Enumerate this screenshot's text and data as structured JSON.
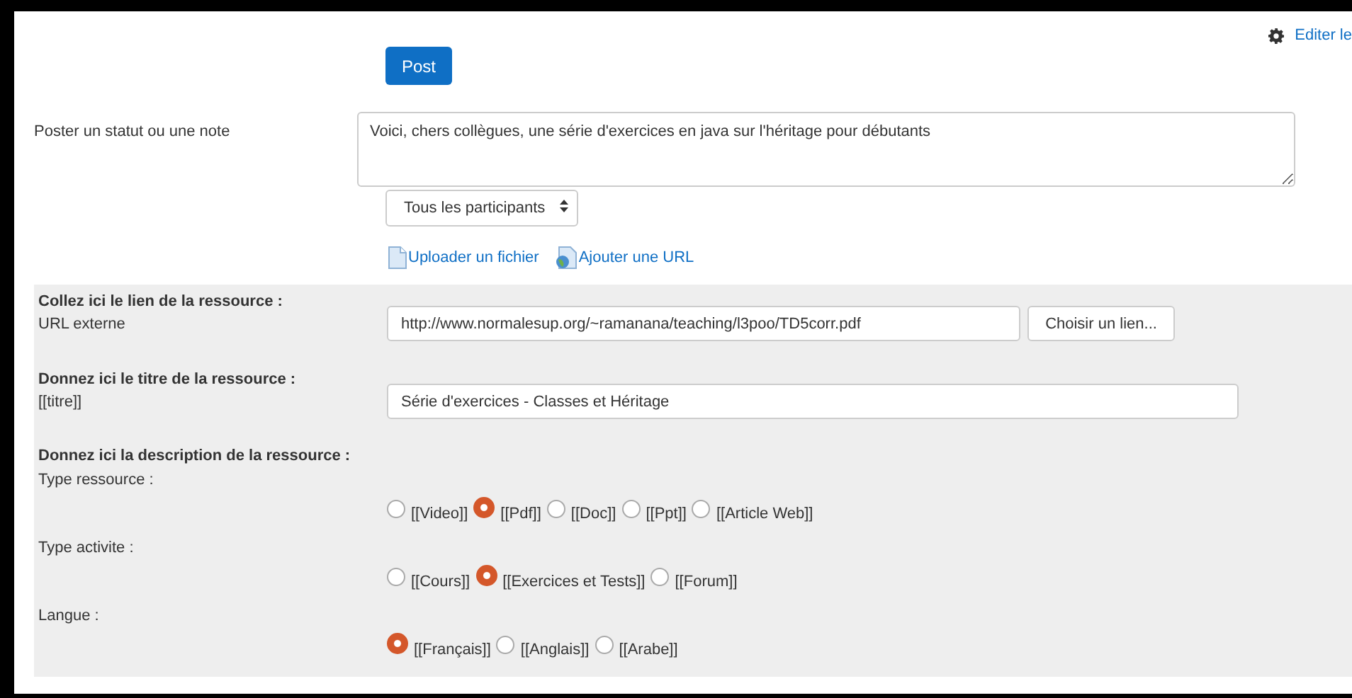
{
  "header_link": {
    "label": "Editer le"
  },
  "post_button": {
    "label": "Post"
  },
  "status": {
    "label": "Poster un statut ou une note",
    "value": "Voici, chers collègues, une série d'exercices en java sur l'héritage pour débutants"
  },
  "audience_select": {
    "value": "Tous les participants"
  },
  "attachments": [
    {
      "kind": "file",
      "label": "Uploader un fichier"
    },
    {
      "kind": "url",
      "label": "Ajouter une URL"
    }
  ],
  "resource_form": {
    "link_heading": "Collez ici le lien de la ressource :",
    "url_label": "URL externe",
    "url_value": "http://www.normalesup.org/~ramanana/teaching/l3poo/TD5corr.pdf",
    "choose_button": "Choisir un lien...",
    "title_heading": "Donnez ici le titre de la ressource :",
    "title_label": "[[titre]]",
    "title_value": "Série d'exercices - Classes et Héritage",
    "description_heading": "Donnez ici la description de la ressource :",
    "radio_groups": [
      {
        "label": "Type ressource :",
        "options": [
          {
            "label": "[[Video]]",
            "selected": false
          },
          {
            "label": "[[Pdf]]",
            "selected": true
          },
          {
            "label": "[[Doc]]",
            "selected": false
          },
          {
            "label": "[[Ppt]]",
            "selected": false
          },
          {
            "label": "[[Article Web]]",
            "selected": false
          }
        ]
      },
      {
        "label": "Type activite :",
        "options": [
          {
            "label": "[[Cours]]",
            "selected": false
          },
          {
            "label": "[[Exercices et Tests]]",
            "selected": true
          },
          {
            "label": "[[Forum]]",
            "selected": false
          }
        ]
      },
      {
        "label": "Langue :",
        "options": [
          {
            "label": "[[Français]]",
            "selected": true
          },
          {
            "label": "[[Anglais]]",
            "selected": false
          },
          {
            "label": "[[Arabe]]",
            "selected": false
          }
        ]
      }
    ]
  }
}
